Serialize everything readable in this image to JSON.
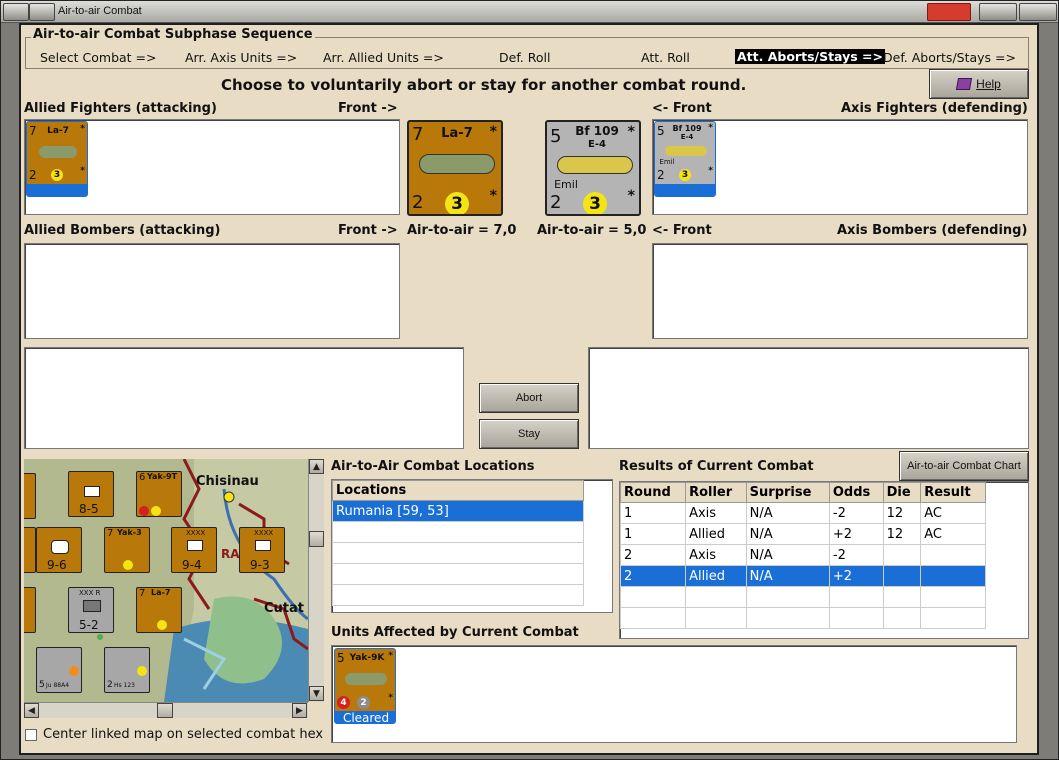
{
  "window": {
    "title": "Air-to-air Combat"
  },
  "sequence": {
    "group_title": "Air-to-air Combat Subphase Sequence",
    "steps": [
      "Select Combat =>",
      "Arr. Axis Units =>",
      "Arr. Allied Units =>",
      "Def. Roll",
      "Att. Roll",
      "Att. Aborts/Stays =>",
      "Def. Aborts/Stays =>"
    ],
    "active_step": "Att. Aborts/Stays =>"
  },
  "prompt": "Choose to voluntarily abort or stay for another combat round.",
  "help_label": "Help",
  "allied_fighters": {
    "label": "Allied Fighters (attacking)",
    "front": "Front ->",
    "unit": {
      "name": "La-7",
      "attack": "7",
      "defense": "2",
      "range": "3"
    }
  },
  "axis_fighters": {
    "label": "Axis Fighters (defending)",
    "front": "<- Front",
    "unit": {
      "name": "Bf 109",
      "variant": "E-4",
      "nickname": "Emil",
      "attack": "5",
      "defense": "2",
      "range": "3"
    }
  },
  "allied_bombers": {
    "label": "Allied Bombers (attacking)",
    "front": "Front ->"
  },
  "axis_bombers": {
    "label": "Axis Bombers (defending)",
    "front": "<- Front"
  },
  "allied_air_to_air": "Air-to-air = 7,0",
  "axis_air_to_air": "Air-to-air = 5,0",
  "buttons": {
    "abort": "Abort",
    "stay": "Stay",
    "chart": "Air-to-air Combat Chart"
  },
  "locations": {
    "title": "Air-to-Air Combat Locations",
    "column": "Locations",
    "rows": [
      "Rumania [59, 53]"
    ]
  },
  "results": {
    "title": "Results of Current Combat",
    "columns": [
      "Round",
      "Roller",
      "Surprise",
      "Odds",
      "Die",
      "Result"
    ],
    "rows": [
      [
        "1",
        "Axis",
        "N/A",
        "-2",
        "12",
        "AC"
      ],
      [
        "1",
        "Allied",
        "N/A",
        "+2",
        "12",
        "AC"
      ],
      [
        "2",
        "Axis",
        "N/A",
        "-2",
        "",
        ""
      ],
      [
        "2",
        "Allied",
        "N/A",
        "+2",
        "",
        ""
      ]
    ],
    "selected_row": 3
  },
  "units_affected": {
    "title": "Units Affected by Current Combat",
    "unit": {
      "name": "Yak-9K",
      "attack": "5",
      "red_value": "4",
      "grey_value": "2",
      "status": "Cleared"
    }
  },
  "map": {
    "place_chisinau": "Chisinau",
    "place_cutat": "Cutat",
    "place_ra": "RA",
    "counters": [
      {
        "text": "8-5",
        "top": "XXXX"
      },
      {
        "text": "9-6",
        "top": ""
      },
      {
        "text": "9-4",
        "top": "XXXX"
      },
      {
        "text": "9-3",
        "top": "XXXX"
      },
      {
        "text": "5-2",
        "top": "XXX R"
      },
      {
        "text": "Yak-3",
        "top": "7"
      },
      {
        "text": "Yak-9T",
        "top": "6"
      },
      {
        "text": "La-7",
        "top": "7"
      },
      {
        "text": "Ju 88A4",
        "top": "5"
      },
      {
        "text": "Hs 123",
        "top": "2"
      }
    ]
  },
  "center_map_checkbox": "Center linked map on selected combat hex",
  "colors": {
    "tan": "#e8dcc4",
    "counter_brown": "#b8780a",
    "axis_grey": "#b4b4b4",
    "select_blue": "#1a6fd6",
    "yellow_circle": "#f5e414"
  }
}
